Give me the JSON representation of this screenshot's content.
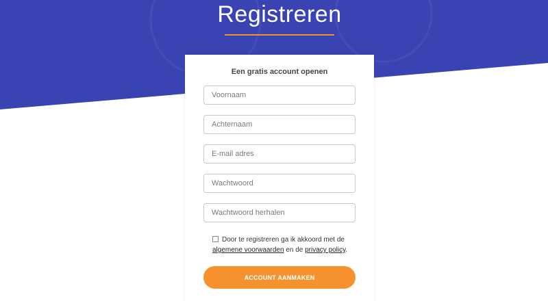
{
  "colors": {
    "hero_blue": "#3a43b2",
    "accent_orange": "#f5922e"
  },
  "page": {
    "title": "Registreren"
  },
  "form": {
    "heading": "Een gratis account openen",
    "fields": {
      "first_name": {
        "placeholder": "Voornaam",
        "value": ""
      },
      "last_name": {
        "placeholder": "Achternaam",
        "value": ""
      },
      "email": {
        "placeholder": "E-mail adres",
        "value": ""
      },
      "password": {
        "placeholder": "Wachtwoord",
        "value": ""
      },
      "password_repeat": {
        "placeholder": "Wachtwoord herhalen",
        "value": ""
      }
    },
    "terms": {
      "checked": false,
      "text_before": "Door te registreren ga ik akkoord met de",
      "terms_link": "algemene voorwaarden",
      "text_middle": "en de",
      "privacy_link": "privacy policy",
      "text_end": "."
    },
    "submit_label": "ACCOUNT AANMAKEN"
  }
}
